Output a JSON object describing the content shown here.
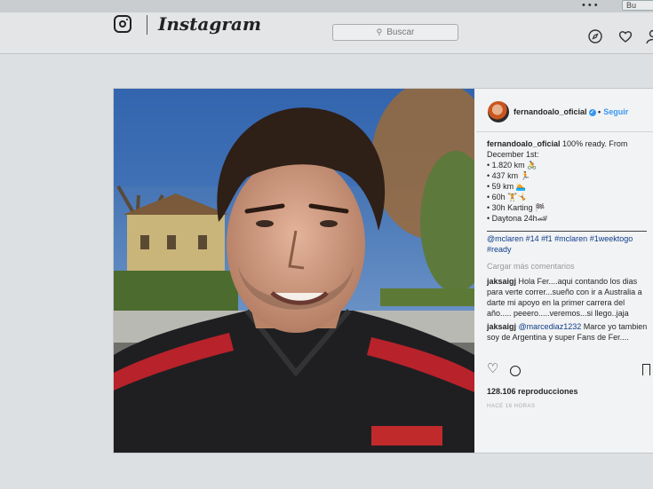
{
  "browser": {
    "dots": "•••",
    "addr_text": "Bu"
  },
  "header": {
    "app_name": "Instagram",
    "search_label": "Buscar"
  },
  "post": {
    "username": "fernandoalo_oficial",
    "follow_label": "Seguir",
    "caption_lines": [
      "100% ready. From",
      "December 1st:",
      "• 1.820 km 🚴",
      "• 437 km 🏃",
      "• 59 km 🏊",
      "• 60h 🏋🤸",
      "• 30h Karting 🏁",
      "• Daytona 24h🏎"
    ],
    "hashtags": "@mclaren #14 #f1 #mclaren #1weektogo #ready",
    "load_more": "Cargar más comentarios",
    "comments": [
      {
        "user": "jaksaigj",
        "mention": "",
        "text": "Hola Fer....aqui contando los dias para verte correr...sueño con ir a Australia a darte mi apoyo en la primer carrera del año..... peeero.....veremos...si llego..jaja"
      },
      {
        "user": "jaksaigj",
        "mention": "@marcediaz1232",
        "text": "Marce yo tambien soy de Argentina y super Fans de Fer...."
      }
    ],
    "views": "128.106 reproducciones",
    "time_ago": "HACE 16 HORAS"
  }
}
